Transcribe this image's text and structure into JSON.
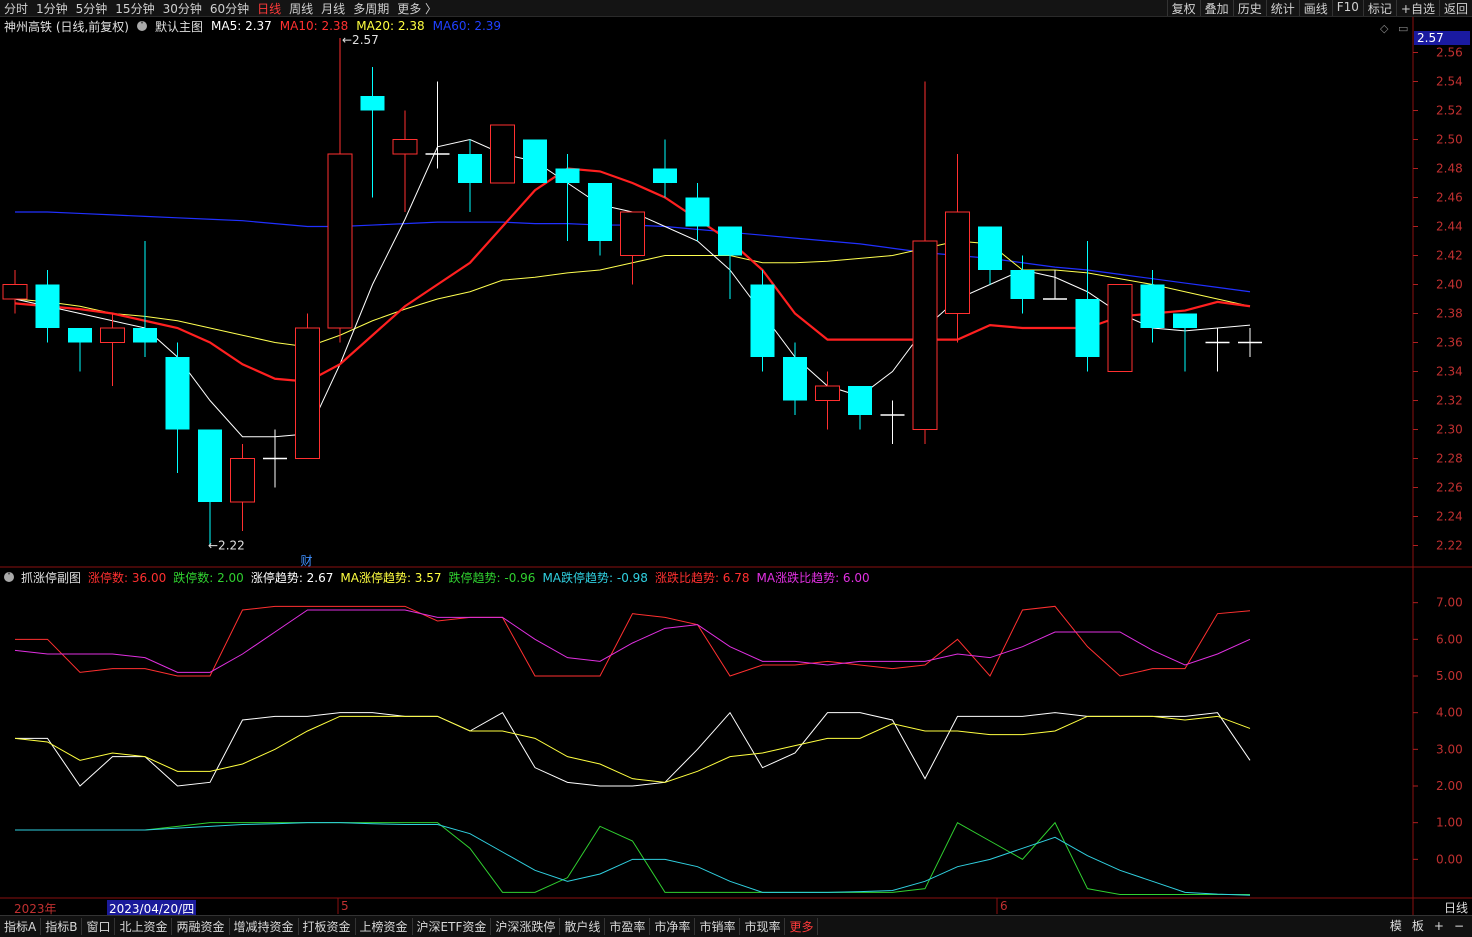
{
  "toolbar": {
    "periods": [
      "分时",
      "1分钟",
      "5分钟",
      "15分钟",
      "30分钟",
      "60分钟",
      "日线",
      "周线",
      "月线",
      "多周期",
      "更多 〉"
    ],
    "active_period": "日线",
    "right_items": [
      "复权",
      "叠加",
      "历史",
      "统计",
      "画线",
      "F10",
      "标记",
      "+自选",
      "返回"
    ]
  },
  "main_legend": {
    "stock_name": "神州高铁 (日线,前复权)",
    "chart_name": "默认主图",
    "ma5": "MA5: 2.37",
    "ma10": "MA10: 2.38",
    "ma20": "MA20: 2.38",
    "ma60": "MA60: 2.39"
  },
  "sub_legend": {
    "name": "抓涨停副图",
    "items": [
      {
        "text": "涨停数: 36.00",
        "color": "#ff3030"
      },
      {
        "text": "跌停数: 2.00",
        "color": "#30d030"
      },
      {
        "text": "涨停趋势: 2.67",
        "color": "#ffffff"
      },
      {
        "text": "MA涨停趋势: 3.57",
        "color": "#ffff40"
      },
      {
        "text": "跌停趋势: -0.96",
        "color": "#30d030"
      },
      {
        "text": "MA跌停趋势: -0.98",
        "color": "#30d0e0"
      },
      {
        "text": "涨跌比趋势: 6.78",
        "color": "#ff3030"
      },
      {
        "text": "MA涨跌比趋势: 6.00",
        "color": "#e030e0"
      }
    ]
  },
  "price_axis": {
    "ticks": [
      "2.56",
      "2.54",
      "2.52",
      "2.50",
      "2.48",
      "2.46",
      "2.44",
      "2.42",
      "2.40",
      "2.38",
      "2.36",
      "2.34",
      "2.32",
      "2.30",
      "2.28",
      "2.26",
      "2.24",
      "2.22"
    ],
    "current": "2.57"
  },
  "sub_axis": {
    "ticks": [
      "7.00",
      "6.00",
      "5.00",
      "4.00",
      "3.00",
      "2.00",
      "1.00",
      "0.00"
    ]
  },
  "annotations": {
    "high": "2.57",
    "low": "2.22",
    "fin_mark": "财",
    "year_label": "2023年",
    "date_highlight": "2023/04/20/四",
    "month5": "5",
    "month6": "6",
    "mode": "日线"
  },
  "bottom_tabs": [
    "指标A",
    "指标B",
    "窗口",
    "北上资金",
    "两融资金",
    "增减持资金",
    "打板资金",
    "上榜资金",
    "沪深ETF资金",
    "沪深涨跌停",
    "散户线",
    "市盈率",
    "市净率",
    "市销率",
    "市现率",
    "更多"
  ],
  "bottom_right": [
    "模",
    "板",
    "+",
    "−"
  ],
  "colors": {
    "up": "#ff3030",
    "down": "#00ffff",
    "ma5": "#ffffff",
    "ma10": "#ff2020",
    "ma20": "#ffff50",
    "ma60": "#2030ff"
  },
  "chart_data": {
    "type": "candlestick",
    "ylim": [
      2.21,
      2.57
    ],
    "candles": [
      {
        "o": 2.39,
        "c": 2.4,
        "h": 2.41,
        "l": 2.38
      },
      {
        "o": 2.4,
        "c": 2.37,
        "h": 2.41,
        "l": 2.36
      },
      {
        "o": 2.37,
        "c": 2.36,
        "h": 2.37,
        "l": 2.34
      },
      {
        "o": 2.36,
        "c": 2.37,
        "h": 2.38,
        "l": 2.33
      },
      {
        "o": 2.37,
        "c": 2.36,
        "h": 2.43,
        "l": 2.35
      },
      {
        "o": 2.35,
        "c": 2.3,
        "h": 2.36,
        "l": 2.27
      },
      {
        "o": 2.3,
        "c": 2.25,
        "h": 2.3,
        "l": 2.22
      },
      {
        "o": 2.25,
        "c": 2.28,
        "h": 2.29,
        "l": 2.23
      },
      {
        "o": 2.28,
        "c": 2.28,
        "h": 2.3,
        "l": 2.26
      },
      {
        "o": 2.28,
        "c": 2.37,
        "h": 2.38,
        "l": 2.28
      },
      {
        "o": 2.37,
        "c": 2.49,
        "h": 2.57,
        "l": 2.36
      },
      {
        "o": 2.53,
        "c": 2.52,
        "h": 2.55,
        "l": 2.46
      },
      {
        "o": 2.49,
        "c": 2.5,
        "h": 2.52,
        "l": 2.45
      },
      {
        "o": 2.49,
        "c": 2.49,
        "h": 2.54,
        "l": 2.48
      },
      {
        "o": 2.49,
        "c": 2.47,
        "h": 2.5,
        "l": 2.45
      },
      {
        "o": 2.47,
        "c": 2.51,
        "h": 2.51,
        "l": 2.47
      },
      {
        "o": 2.5,
        "c": 2.47,
        "h": 2.5,
        "l": 2.47
      },
      {
        "o": 2.48,
        "c": 2.47,
        "h": 2.49,
        "l": 2.43
      },
      {
        "o": 2.47,
        "c": 2.43,
        "h": 2.47,
        "l": 2.42
      },
      {
        "o": 2.42,
        "c": 2.45,
        "h": 2.45,
        "l": 2.4
      },
      {
        "o": 2.48,
        "c": 2.47,
        "h": 2.5,
        "l": 2.46
      },
      {
        "o": 2.46,
        "c": 2.44,
        "h": 2.47,
        "l": 2.43
      },
      {
        "o": 2.44,
        "c": 2.42,
        "h": 2.44,
        "l": 2.39
      },
      {
        "o": 2.4,
        "c": 2.35,
        "h": 2.41,
        "l": 2.34
      },
      {
        "o": 2.35,
        "c": 2.32,
        "h": 2.36,
        "l": 2.31
      },
      {
        "o": 2.32,
        "c": 2.33,
        "h": 2.34,
        "l": 2.3
      },
      {
        "o": 2.33,
        "c": 2.31,
        "h": 2.33,
        "l": 2.3
      },
      {
        "o": 2.31,
        "c": 2.31,
        "h": 2.32,
        "l": 2.29
      },
      {
        "o": 2.3,
        "c": 2.43,
        "h": 2.54,
        "l": 2.29
      },
      {
        "o": 2.38,
        "c": 2.45,
        "h": 2.49,
        "l": 2.36
      },
      {
        "o": 2.44,
        "c": 2.41,
        "h": 2.44,
        "l": 2.4
      },
      {
        "o": 2.41,
        "c": 2.39,
        "h": 2.42,
        "l": 2.38
      },
      {
        "o": 2.39,
        "c": 2.39,
        "h": 2.41,
        "l": 2.39
      },
      {
        "o": 2.39,
        "c": 2.35,
        "h": 2.43,
        "l": 2.34
      },
      {
        "o": 2.34,
        "c": 2.4,
        "h": 2.4,
        "l": 2.34
      },
      {
        "o": 2.4,
        "c": 2.37,
        "h": 2.41,
        "l": 2.36
      },
      {
        "o": 2.38,
        "c": 2.37,
        "h": 2.38,
        "l": 2.34
      },
      {
        "o": 2.36,
        "c": 2.36,
        "h": 2.37,
        "l": 2.34
      },
      {
        "o": 2.36,
        "c": 2.36,
        "h": 2.37,
        "l": 2.35
      }
    ],
    "ma5": [
      2.39,
      2.385,
      2.38,
      2.375,
      2.37,
      2.35,
      2.32,
      2.295,
      2.295,
      2.297,
      2.345,
      2.4,
      2.445,
      2.495,
      2.5,
      2.49,
      2.485,
      2.47,
      2.455,
      2.45,
      2.44,
      2.43,
      2.41,
      2.38,
      2.35,
      2.33,
      2.323,
      2.34,
      2.37,
      2.39,
      2.4,
      2.41,
      2.405,
      2.395,
      2.38,
      2.37,
      2.368,
      2.37,
      2.372
    ],
    "ma10": [
      2.387,
      2.385,
      2.383,
      2.38,
      2.375,
      2.37,
      2.36,
      2.345,
      2.335,
      2.333,
      2.345,
      2.365,
      2.385,
      2.4,
      2.415,
      2.44,
      2.465,
      2.48,
      2.478,
      2.47,
      2.46,
      2.445,
      2.43,
      2.41,
      2.38,
      2.362,
      2.362,
      2.362,
      2.362,
      2.362,
      2.372,
      2.37,
      2.37,
      2.37,
      2.378,
      2.38,
      2.382,
      2.388,
      2.385
    ],
    "ma20": [
      2.39,
      2.388,
      2.385,
      2.38,
      2.378,
      2.375,
      2.37,
      2.365,
      2.36,
      2.357,
      2.365,
      2.375,
      2.383,
      2.39,
      2.395,
      2.403,
      2.405,
      2.408,
      2.41,
      2.415,
      2.42,
      2.42,
      2.42,
      2.415,
      2.415,
      2.416,
      2.418,
      2.42,
      2.425,
      2.43,
      2.428,
      2.41,
      2.41,
      2.408,
      2.404,
      2.4,
      2.395,
      2.39,
      2.385
    ],
    "ma60": [
      2.45,
      2.45,
      2.449,
      2.448,
      2.447,
      2.446,
      2.445,
      2.444,
      2.442,
      2.44,
      2.44,
      2.441,
      2.442,
      2.443,
      2.443,
      2.443,
      2.442,
      2.442,
      2.441,
      2.441,
      2.44,
      2.438,
      2.436,
      2.434,
      2.432,
      2.43,
      2.428,
      2.425,
      2.422,
      2.42,
      2.418,
      2.415,
      2.412,
      2.41,
      2.407,
      2.404,
      2.401,
      2.398,
      2.395
    ],
    "sub": {
      "ylim": [
        -1.0,
        7.4
      ],
      "series": [
        {
          "name": "涨跌比趋势",
          "color": "#ff3030",
          "values": [
            6.0,
            6.0,
            5.1,
            5.2,
            5.2,
            5.0,
            5.0,
            6.8,
            6.9,
            6.9,
            6.9,
            6.9,
            6.9,
            6.5,
            6.6,
            6.6,
            5.0,
            5.0,
            5.0,
            6.7,
            6.6,
            6.4,
            5.0,
            5.3,
            5.3,
            5.4,
            5.3,
            5.2,
            5.3,
            6.0,
            5.0,
            6.8,
            6.9,
            5.8,
            5.0,
            5.2,
            5.2,
            6.7,
            6.78
          ]
        },
        {
          "name": "MA涨跌比趋势",
          "color": "#e030e0",
          "values": [
            5.7,
            5.6,
            5.6,
            5.6,
            5.5,
            5.1,
            5.1,
            5.6,
            6.2,
            6.8,
            6.8,
            6.8,
            6.8,
            6.6,
            6.6,
            6.6,
            6.0,
            5.5,
            5.4,
            5.9,
            6.3,
            6.4,
            5.8,
            5.4,
            5.4,
            5.3,
            5.4,
            5.4,
            5.4,
            5.6,
            5.5,
            5.8,
            6.2,
            6.2,
            6.2,
            5.7,
            5.3,
            5.6,
            6.0
          ]
        },
        {
          "name": "涨停趋势",
          "color": "#ffffff",
          "values": [
            3.3,
            3.3,
            2.0,
            2.8,
            2.8,
            2.0,
            2.1,
            3.8,
            3.9,
            3.9,
            4.0,
            4.0,
            3.9,
            3.9,
            3.5,
            4.0,
            2.5,
            2.1,
            2.0,
            2.0,
            2.1,
            3.0,
            4.0,
            2.5,
            2.9,
            4.0,
            4.0,
            3.8,
            2.2,
            3.9,
            3.9,
            3.9,
            4.0,
            3.9,
            3.9,
            3.9,
            3.9,
            4.0,
            2.7
          ]
        },
        {
          "name": "MA涨停趋势",
          "color": "#ffff40",
          "values": [
            3.3,
            3.2,
            2.7,
            2.9,
            2.8,
            2.4,
            2.4,
            2.6,
            3.0,
            3.5,
            3.9,
            3.9,
            3.9,
            3.9,
            3.5,
            3.5,
            3.3,
            2.8,
            2.6,
            2.2,
            2.1,
            2.4,
            2.8,
            2.9,
            3.1,
            3.3,
            3.3,
            3.7,
            3.5,
            3.5,
            3.4,
            3.4,
            3.5,
            3.9,
            3.9,
            3.9,
            3.8,
            3.9,
            3.57
          ]
        },
        {
          "name": "跌停趋势",
          "color": "#30d030",
          "values": [
            0.8,
            0.8,
            0.8,
            0.8,
            0.8,
            0.9,
            1.0,
            1.0,
            1.0,
            1.0,
            1.0,
            1.0,
            1.0,
            1.0,
            0.3,
            -0.9,
            -0.9,
            -0.5,
            0.9,
            0.5,
            -0.9,
            -0.9,
            -0.9,
            -0.9,
            -0.9,
            -0.9,
            -0.9,
            -0.9,
            -0.8,
            1.0,
            0.5,
            0.0,
            1.0,
            -0.8,
            -0.96,
            -0.96,
            -0.96,
            -0.96,
            -0.96
          ]
        },
        {
          "name": "MA跌停趋势",
          "color": "#30d0e0",
          "values": [
            0.8,
            0.8,
            0.8,
            0.8,
            0.8,
            0.85,
            0.9,
            0.95,
            0.97,
            1.0,
            1.0,
            0.97,
            0.95,
            0.95,
            0.7,
            0.2,
            -0.3,
            -0.6,
            -0.4,
            0.0,
            0.0,
            -0.2,
            -0.6,
            -0.9,
            -0.9,
            -0.9,
            -0.88,
            -0.85,
            -0.6,
            -0.2,
            0.0,
            0.3,
            0.6,
            0.1,
            -0.3,
            -0.6,
            -0.9,
            -0.95,
            -0.98
          ]
        }
      ]
    }
  }
}
